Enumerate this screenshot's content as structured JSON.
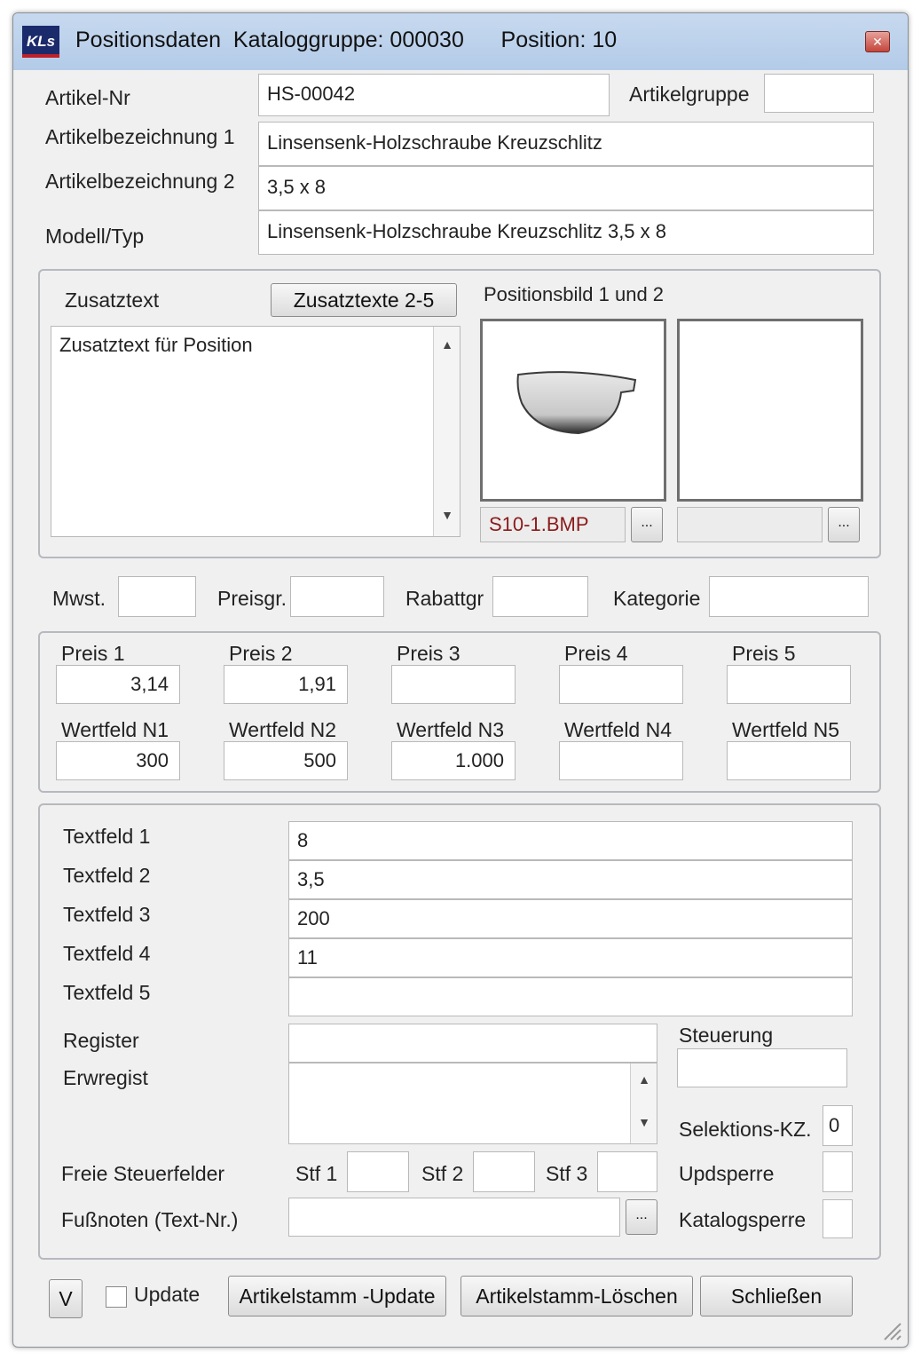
{
  "window": {
    "title": "Positionsdaten  Kataloggruppe: 000030      Position: 10",
    "logo_text": "KLs",
    "close_label": "✕"
  },
  "header": {
    "artikel_nr_label": "Artikel-Nr",
    "artikel_nr_value": "HS-00042",
    "artikelgruppe_label": "Artikelgruppe",
    "artikelgruppe_value": "",
    "bez1_label": "Artikelbezeichnung 1",
    "bez1_value": "Linsensenk-Holzschraube Kreuzschlitz",
    "bez2_label": "Artikelbezeichnung 2",
    "bez2_value": "3,5 x 8",
    "modell_label": "Modell/Typ",
    "modell_value": "Linsensenk-Holzschraube Kreuzschlitz 3,5 x 8"
  },
  "zusatz": {
    "label": "Zusatztext",
    "button": "Zusatztexte 2-5",
    "text": "Zusatztext für Position",
    "bild_label": "Positionsbild 1 und 2",
    "bild1_file": "S10-1.BMP",
    "bild2_file": "",
    "browse": "..."
  },
  "codes": {
    "mwst_label": "Mwst.",
    "mwst_value": "",
    "preisgr_label": "Preisgr.",
    "preisgr_value": "",
    "rabattgr_label": "Rabattgr",
    "rabattgr_value": "",
    "kategorie_label": "Kategorie",
    "kategorie_value": ""
  },
  "preise": [
    {
      "label": "Preis 1",
      "value": "3,14"
    },
    {
      "label": "Preis 2",
      "value": "1,91"
    },
    {
      "label": "Preis 3",
      "value": ""
    },
    {
      "label": "Preis 4",
      "value": ""
    },
    {
      "label": "Preis 5",
      "value": ""
    }
  ],
  "wertfelder": [
    {
      "label": "Wertfeld N1",
      "value": "300"
    },
    {
      "label": "Wertfeld N2",
      "value": "500"
    },
    {
      "label": "Wertfeld N3",
      "value": "1.000"
    },
    {
      "label": "Wertfeld N4",
      "value": ""
    },
    {
      "label": "Wertfeld N5",
      "value": ""
    }
  ],
  "textfelder": [
    {
      "label": "Textfeld 1",
      "value": "8"
    },
    {
      "label": "Textfeld 2",
      "value": "3,5"
    },
    {
      "label": "Textfeld 3",
      "value": "200"
    },
    {
      "label": "Textfeld 4",
      "value": "11"
    },
    {
      "label": "Textfeld 5",
      "value": ""
    }
  ],
  "register": {
    "register_label": "Register",
    "register_value": "",
    "erwregist_label": "Erwregist",
    "erwregist_value": "",
    "steuerung_label": "Steuerung",
    "steuerung_value": "",
    "selektion_label": "Selektions-KZ.",
    "selektion_value": "0",
    "freie_label": "Freie Steuerfelder",
    "stf1_label": "Stf 1",
    "stf1_value": "",
    "stf2_label": "Stf 2",
    "stf2_value": "",
    "stf3_label": "Stf 3",
    "stf3_value": "",
    "updsperre_label": "Updsperre",
    "updsperre_value": "",
    "fussnoten_label": "Fußnoten (Text-Nr.)",
    "fussnoten_value": "",
    "katalogsperre_label": "Katalogsperre",
    "katalogsperre_value": ""
  },
  "footer": {
    "v_label": "V",
    "update_label": "Update",
    "update_checked": false,
    "artikelstamm_update": "Artikelstamm -Update",
    "artikelstamm_loeschen": "Artikelstamm-Löschen",
    "schliessen": "Schließen"
  }
}
